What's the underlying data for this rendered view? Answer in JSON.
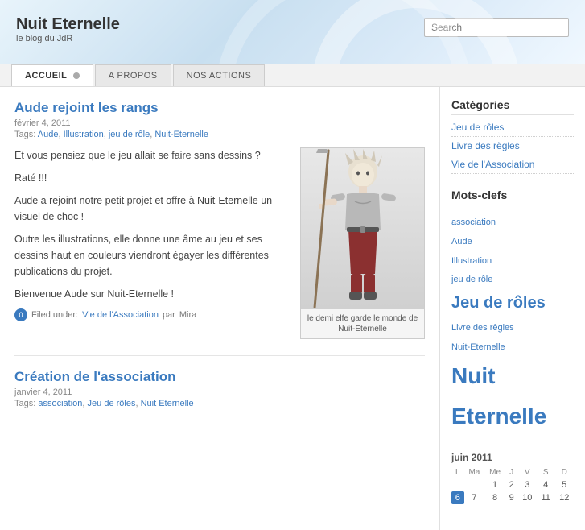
{
  "header": {
    "site_title": "Nuit Eternelle",
    "site_subtitle": "le blog du JdR",
    "search_placeholder": "Search"
  },
  "nav": {
    "tabs": [
      {
        "label": "ACCUEIL",
        "active": true,
        "has_indicator": true
      },
      {
        "label": "A PROPOS",
        "active": false,
        "has_indicator": false
      },
      {
        "label": "NOS ACTIONS",
        "active": false,
        "has_indicator": false
      }
    ]
  },
  "posts": [
    {
      "id": "post1",
      "title": "Aude rejoint les rangs",
      "date": "février 4, 2011",
      "tags_label": "Tags:",
      "tags": [
        "Aude",
        "Illustration",
        "jeu de rôle",
        "Nuit-Eternelle"
      ],
      "body": [
        "Et vous pensiez que le jeu allait se faire sans dessins ?",
        "Raté !!!",
        "Aude a rejoint notre petit projet et offre à Nuit-Eternelle un visuel de choc !",
        "Outre les illustrations, elle donne une âme au jeu et ses dessins haut en couleurs viendront égayer les différentes publications du projet.",
        "Bienvenue Aude sur Nuit-Eternelle !"
      ],
      "image_caption": "le demi elfe garde le monde de Nuit-Eternelle",
      "filed_under_label": "Filed under:",
      "filed_category": "Vie de l'Association",
      "filed_by_label": "par",
      "filed_by": "Mira"
    },
    {
      "id": "post2",
      "title": "Création de l'association",
      "date": "janvier 4, 2011",
      "tags_label": "Tags:",
      "tags": [
        "association",
        "Jeu de rôles",
        "Nuit Eternelle"
      ]
    }
  ],
  "sidebar": {
    "categories_title": "Catégories",
    "categories": [
      "Jeu de rôles",
      "Livre des règles",
      "Vie de l'Association"
    ],
    "tags_title": "Mots-clefs",
    "tags": [
      {
        "label": "association",
        "size": "sm"
      },
      {
        "label": "Aude",
        "sm": true,
        "size": "sm"
      },
      {
        "label": "Illustration",
        "size": "sm"
      },
      {
        "label": "jeu de rôle",
        "size": "sm"
      },
      {
        "label": "Jeu de rôles",
        "size": "lg"
      },
      {
        "label": "Livre des règles",
        "size": "sm"
      },
      {
        "label": "Nuit-Eternelle",
        "size": "sm"
      },
      {
        "label": "Nuit Eternelle",
        "size": "xl"
      }
    ],
    "calendar_month": "juin 2011",
    "calendar_headers": [
      "L",
      "Ma",
      "Me",
      "J",
      "V",
      "S",
      "D"
    ],
    "calendar_rows": [
      [
        "",
        "",
        "1",
        "2",
        "3",
        "4",
        "5"
      ],
      [
        "6",
        "7",
        "8",
        "9",
        "10",
        "11",
        "12"
      ]
    ],
    "calendar_today": "6"
  }
}
